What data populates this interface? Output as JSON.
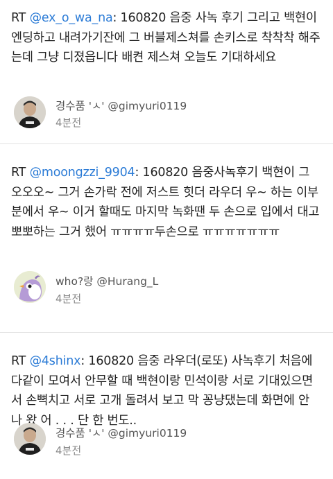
{
  "tweets": [
    {
      "rt_prefix": "RT",
      "mention": "@ex_o_wa_na",
      "text": ": 160820 음중 사녹 후기 그리고 백현이 엔딩하고 내려가기잔에 그 버블제스쳐를 손키스로 착착착 해주는데 그냥 디졌읍니다 배켠 제스쳐 오늘도 기대하세요",
      "author": "경수품 'ㅅ' @gimyuri0119",
      "time": "4분전",
      "avatar_icon": "person-avatar"
    },
    {
      "rt_prefix": "RT",
      "mention": "@moongzzi_9904",
      "text": ": 160820 음중사녹후기 백현이 그 오오오~ 그거 손가락 전에 저스트 힛더 라우더 우~ 하는 이부분에서 우~ 이거 할때도 마지막 녹화땐 두 손으로 입에서 대고 뽀뽀하는 그거 했어 ㅠㅠㅠㅠ두손으로 ㅠㅠㅠㅠㅠㅠㅠ",
      "author": "who?랑 @Hurang_L",
      "time": "4분전",
      "avatar_icon": "cartoon-bird-avatar"
    },
    {
      "rt_prefix": "RT",
      "mention": "@4shinx",
      "text": ": 160820 음중 라우더(로또) 사녹후기 처음에 다같이 모여서 안무할 때 백현이랑 민석이랑 서로 기대있으면서 손뼉치고 서로 고개 돌려서 보고 막 꽁냥댔는데 화면에 안 나 왔 어 . . . 단 한 번도..",
      "author": "경수품 'ㅅ' @gimyuri0119",
      "time": "4분전",
      "avatar_icon": "person-avatar"
    }
  ],
  "colors": {
    "mention": "#2b7bd6",
    "text": "#222222",
    "meta": "#8a8a8a",
    "divider": "#e1e1e1"
  }
}
